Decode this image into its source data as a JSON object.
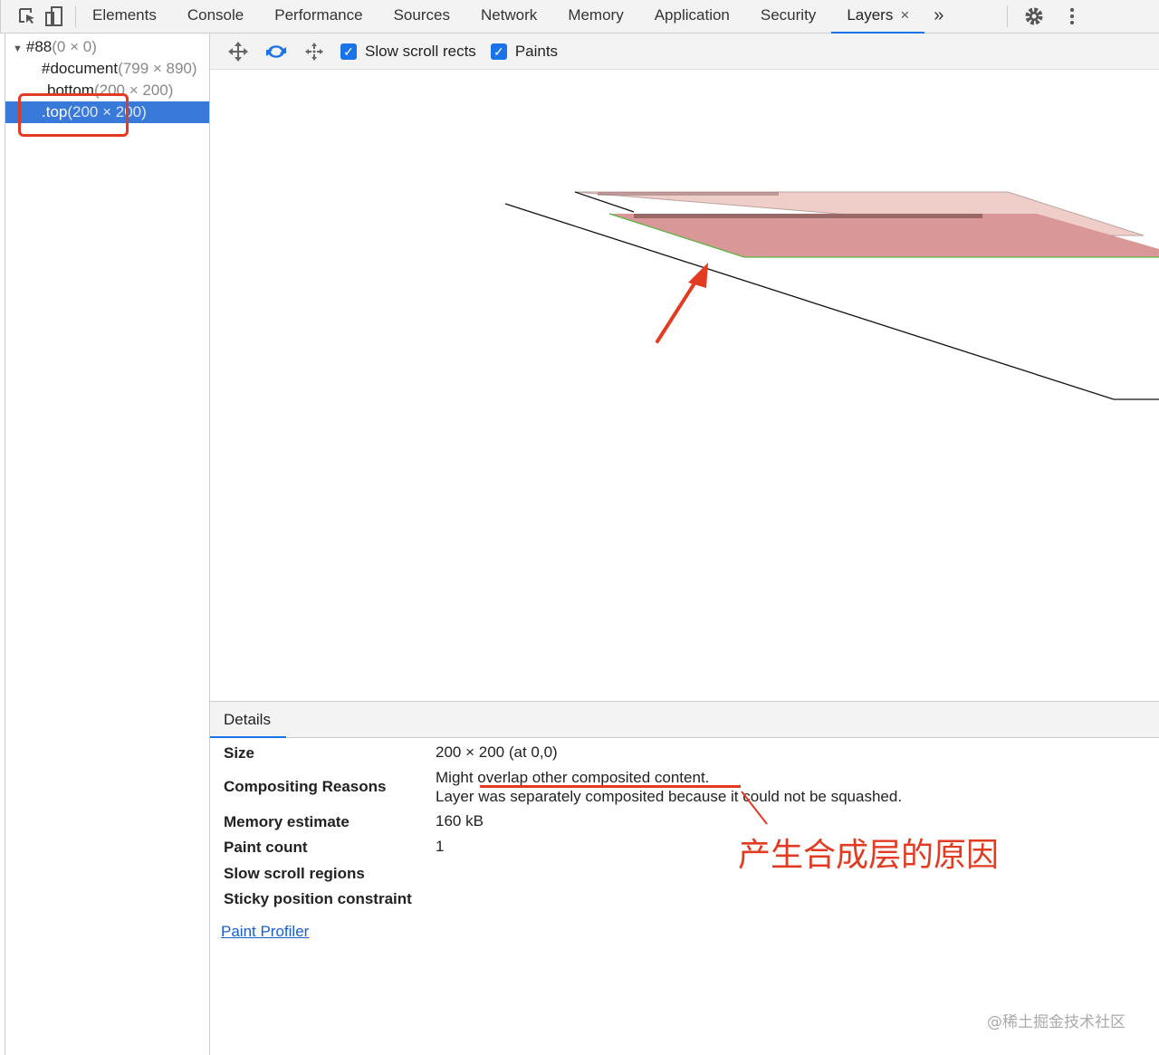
{
  "tabs": [
    "Elements",
    "Console",
    "Performance",
    "Sources",
    "Network",
    "Memory",
    "Application",
    "Security",
    "Layers"
  ],
  "active_tab": "Layers",
  "close_glyph": "×",
  "more_glyph": "»",
  "tree": [
    {
      "name": "#88",
      "size": "(0 × 0)"
    },
    {
      "name": "#document",
      "size": "(799 × 890)"
    },
    {
      "name": "bottom",
      "size": "(200 × 200)"
    },
    {
      "name": ".top",
      "size": "(200 × 200)"
    }
  ],
  "toolbar": {
    "slow_scroll": "Slow scroll rects",
    "paints": "Paints"
  },
  "details": {
    "tab": "Details",
    "rows": [
      {
        "label": "Size",
        "value": "200 × 200 (at 0,0)"
      },
      {
        "label": "Compositing Reasons",
        "value": "Might overlap other composited content.",
        "value2": "Layer was separately composited because it could not be squashed."
      },
      {
        "label": "Memory estimate",
        "value": "160 kB"
      },
      {
        "label": "Paint count",
        "value": "1"
      },
      {
        "label": "Slow scroll regions",
        "value": ""
      },
      {
        "label": "Sticky position constraint",
        "value": ""
      }
    ],
    "link": "Paint Profiler"
  },
  "annotation": "产生合成层的原因",
  "watermark": "@稀土掘金技术社区",
  "colors": {
    "accent": "#1a73e8",
    "selection": "#3879d9",
    "annotation": "#e33a22"
  }
}
